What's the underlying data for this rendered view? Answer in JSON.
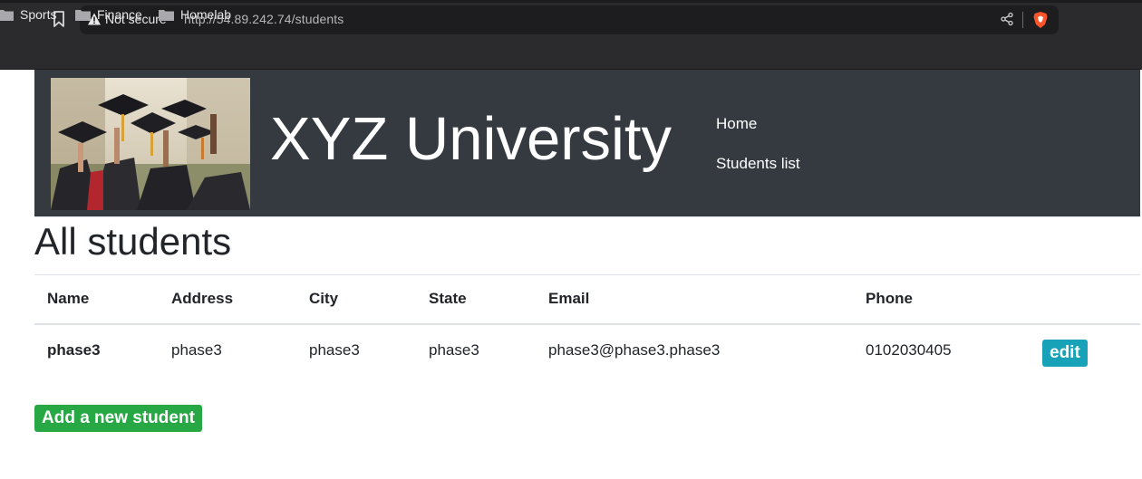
{
  "browser": {
    "security_label": "Not secure",
    "url": "http://54.89.242.74/students",
    "bookmarks": [
      {
        "label": "Sports",
        "icon": "folder-icon"
      },
      {
        "label": "Finance",
        "icon": "folder-icon"
      },
      {
        "label": "Homelab",
        "icon": "folder-icon"
      }
    ],
    "icons": {
      "bookmark": "bookmark-icon",
      "security": "warning-icon",
      "share": "share-icon",
      "brave": "brave-shield-icon"
    }
  },
  "header": {
    "title": "XYZ University",
    "logo_icon": "graduation-caps-photo",
    "nav": [
      {
        "label": "Home"
      },
      {
        "label": "Students list"
      }
    ]
  },
  "page": {
    "heading": "All students",
    "table": {
      "columns": [
        "Name",
        "Address",
        "City",
        "State",
        "Email",
        "Phone",
        ""
      ],
      "rows": [
        {
          "name": "phase3",
          "address": "phase3",
          "city": "phase3",
          "state": "phase3",
          "email": "phase3@phase3.phase3",
          "phone": "0102030405",
          "action_label": "edit"
        }
      ]
    },
    "add_button_label": "Add a new student"
  },
  "colors": {
    "header_bg": "#343a40",
    "edit_button": "#17a2b8",
    "add_button": "#28a745",
    "brave_orange": "#fb542b"
  }
}
